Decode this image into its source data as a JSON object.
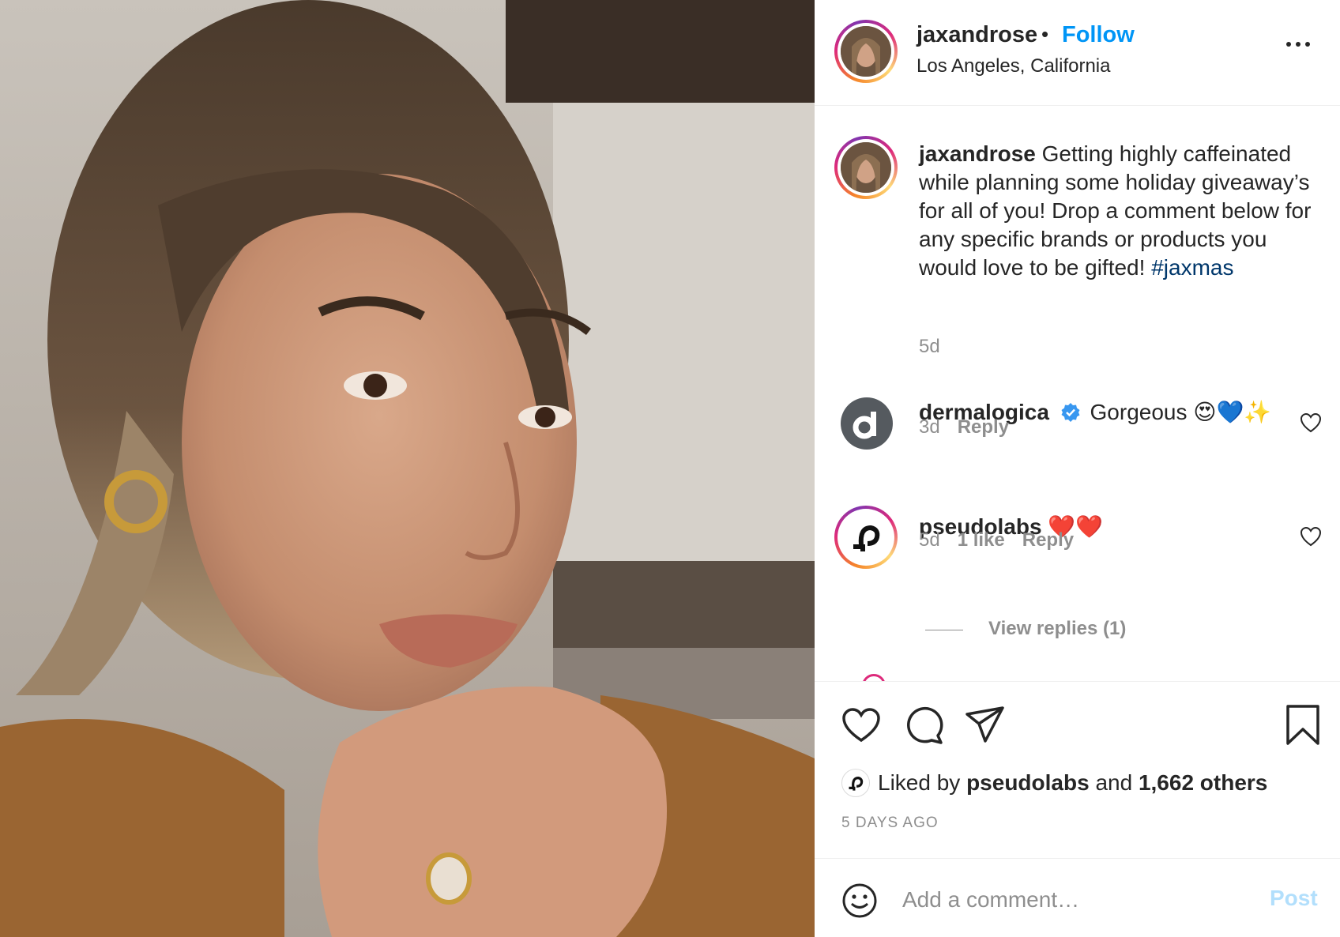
{
  "post": {
    "username": "jaxandrose",
    "separator": "•",
    "follow_label": "Follow",
    "location": "Los Angeles, California",
    "more_icon": "more-horizontal-icon"
  },
  "caption": {
    "username": "jaxandrose",
    "text": "Getting highly caffeinated while planning some holiday giveaway’s for all of you! Drop a comment below for any specific brands or products you would love to be gifted!",
    "hashtag": "#jaxmas",
    "time": "5d"
  },
  "comments": [
    {
      "username": "dermalogica",
      "verified": true,
      "text": "Gorgeous 😍💙✨",
      "time": "3d",
      "likes": "",
      "reply_label": "Reply",
      "avatar_letter": "d"
    },
    {
      "username": "pseudolabs",
      "verified": false,
      "text": "❤️❤️",
      "time": "5d",
      "likes": "1 like",
      "reply_label": "Reply",
      "view_replies": "View replies (1)"
    }
  ],
  "actions": {
    "icons": [
      "heart-icon",
      "comment-icon",
      "share-icon",
      "bookmark-icon"
    ],
    "liked_by_prefix": "Liked by",
    "liked_by_user": "pseudolabs",
    "liked_by_and": "and",
    "liked_by_others": "1,662 others",
    "time_ago": "5 DAYS AGO"
  },
  "add_comment": {
    "placeholder": "Add a comment…",
    "post_label": "Post"
  },
  "colors": {
    "link_blue": "#0095f6",
    "hashtag": "#00376b",
    "muted": "#8e8e8e",
    "post_disabled": "#b2dffc",
    "verified": "#3897f0"
  }
}
